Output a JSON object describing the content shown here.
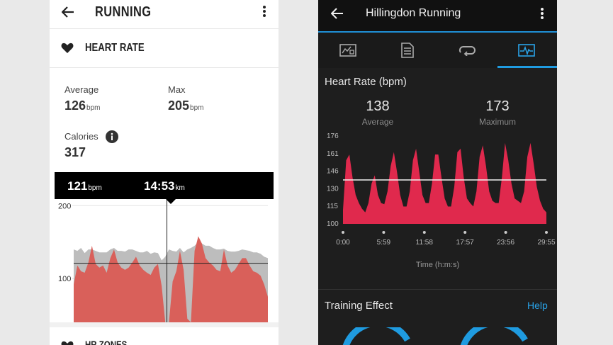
{
  "left": {
    "title": "RUNNING",
    "section_title": "HEART RATE",
    "stats": {
      "average_label": "Average",
      "average_value": "126",
      "average_unit": "bpm",
      "max_label": "Max",
      "max_value": "205",
      "max_unit": "bpm",
      "calories_label": "Calories",
      "calories_value": "317"
    },
    "tooltip": {
      "hr_value": "121",
      "hr_unit": "bpm",
      "distance_value": "14:53",
      "distance_unit": "km"
    },
    "next_section_title": "HR ZONES",
    "chart_data": {
      "type": "area",
      "y_ticks": [
        "200",
        "100"
      ],
      "ylim": [
        40,
        210
      ],
      "series": [
        {
          "color": "#d9605a",
          "values": [
            92,
            118,
            110,
            108,
            122,
            145,
            120,
            115,
            118,
            108,
            128,
            140,
            122,
            115,
            112,
            115,
            122,
            130,
            118,
            112,
            108,
            105,
            115,
            120,
            90,
            40,
            40,
            96,
            110,
            138,
            112,
            45,
            40,
            138,
            158,
            148,
            128,
            122,
            118,
            112,
            110,
            140,
            118,
            108,
            112,
            120,
            128,
            128,
            118,
            110,
            108,
            104,
            92,
            75
          ]
        },
        {
          "color": "#bdbdbd",
          "values": [
            140,
            138,
            142,
            135,
            140,
            140,
            138,
            136,
            136,
            136,
            140,
            142,
            138,
            138,
            137,
            140,
            140,
            138,
            136,
            136,
            138,
            134,
            136,
            135,
            125,
            130,
            140,
            138,
            137,
            142,
            136,
            140,
            142,
            145,
            150,
            148,
            145,
            145,
            142,
            140,
            140,
            141,
            138,
            137,
            137,
            138,
            140,
            139,
            138,
            136,
            136,
            134,
            130,
            128
          ]
        }
      ],
      "horizontal_line": 121,
      "cursor_position": 0.48
    }
  },
  "right": {
    "title": "Hillingdon Running",
    "tabs": [
      {
        "icon": "stats-icon"
      },
      {
        "icon": "splits-icon"
      },
      {
        "icon": "laps-icon"
      },
      {
        "icon": "heart-rate-chart-icon"
      }
    ],
    "section_title": "Heart Rate (bpm)",
    "average_value": "138",
    "average_label": "Average",
    "maximum_value": "173",
    "maximum_label": "Maximum",
    "chart_data": {
      "type": "area",
      "y_ticks": [
        "176",
        "161",
        "146",
        "130",
        "115",
        "100"
      ],
      "ylim": [
        100,
        176
      ],
      "x_ticks": [
        "0:00",
        "5:59",
        "11:58",
        "17:57",
        "23:56",
        "29:55"
      ],
      "xlabel": "Time (h:m:s)",
      "average_line": 138,
      "color": "#e0294d",
      "values": [
        112,
        155,
        160,
        140,
        125,
        118,
        113,
        110,
        118,
        135,
        142,
        125,
        118,
        117,
        128,
        150,
        162,
        145,
        125,
        115,
        115,
        128,
        155,
        165,
        145,
        125,
        118,
        118,
        135,
        160,
        160,
        140,
        122,
        115,
        115,
        132,
        162,
        165,
        140,
        122,
        118,
        115,
        128,
        158,
        168,
        150,
        128,
        120,
        118,
        118,
        140,
        170,
        155,
        135,
        122,
        120,
        118,
        128,
        158,
        170,
        152,
        132,
        120,
        113,
        110
      ]
    },
    "training_effect_title": "Training Effect",
    "help_label": "Help"
  }
}
